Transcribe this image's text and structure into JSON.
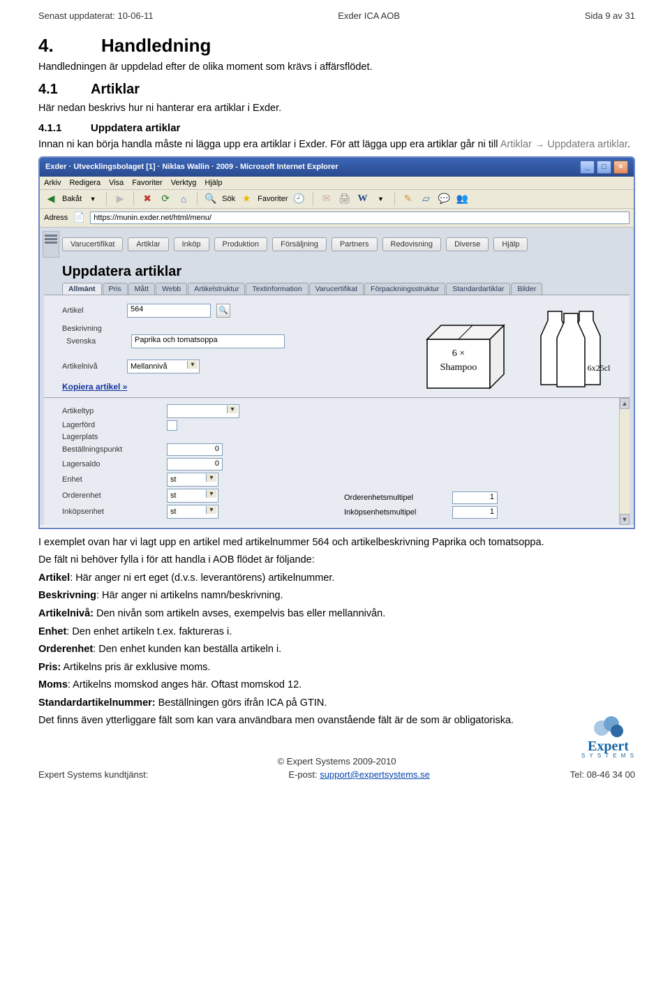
{
  "header": {
    "left": "Senast uppdaterat: 10-06-11",
    "center": "Exder ICA AOB",
    "right": "Sida 9 av 31"
  },
  "h1": {
    "num": "4.",
    "title": "Handledning"
  },
  "p_intro": "Handledningen är uppdelad efter de olika moment som krävs i affärsflödet.",
  "h2": {
    "num": "4.1",
    "title": "Artiklar"
  },
  "p_41": "Här nedan beskrivs hur ni hanterar era artiklar i Exder.",
  "h3": {
    "num": "4.1.1",
    "title": "Uppdatera artiklar"
  },
  "p_411a": "Innan ni kan börja handla måste ni lägga upp era artiklar i Exder. För att lägga upp era artiklar går ni till ",
  "p_411b": "Artiklar → Uppdatera artiklar",
  "p_411c": ".",
  "ie": {
    "title": "Exder · Utvecklingsbolaget [1] · Niklas Wallin · 2009 - Microsoft Internet Explorer",
    "menus": [
      "Arkiv",
      "Redigera",
      "Visa",
      "Favoriter",
      "Verktyg",
      "Hjälp"
    ],
    "toolbar": {
      "back": "Bakåt",
      "sok": "Sök",
      "fav": "Favoriter"
    },
    "address_label": "Adress",
    "address_url": "https://munin.exder.net/html/menu/"
  },
  "app": {
    "tabs": [
      "Varucertifikat",
      "Artiklar",
      "Inköp",
      "Produktion",
      "Försäljning",
      "Partners",
      "Redovisning",
      "Diverse",
      "Hjälp"
    ],
    "page_title": "Uppdatera artiklar",
    "subtabs": [
      "Allmänt",
      "Pris",
      "Mått",
      "Webb",
      "Artikelstruktur",
      "Textinformation",
      "Varucertifikat",
      "Förpackningsstruktur",
      "Standardartiklar",
      "Bilder"
    ],
    "form": {
      "artikel_label": "Artikel",
      "artikel_value": "564",
      "beskrivning_label": "Beskrivning",
      "svenska_label": "Svenska",
      "svenska_value": "Paprika och tomatsoppa",
      "artikelniva_label": "Artikelnivå",
      "artikelniva_value": "Mellannivå",
      "kopiera": "Kopiera artikel »",
      "box_text1": "6 ×",
      "box_text2": "Shampoo",
      "bottle_text": "6x25cl"
    },
    "lower": {
      "rows": [
        {
          "label": "Artikeltyp",
          "type": "select",
          "value": ""
        },
        {
          "label": "Lagerförd",
          "type": "checkbox"
        },
        {
          "label": "Lagerplats",
          "type": "blank"
        },
        {
          "label": "Beställningspunkt",
          "type": "num",
          "value": "0"
        },
        {
          "label": "Lagersaldo",
          "type": "num",
          "value": "0"
        },
        {
          "label": "Enhet",
          "type": "select",
          "value": "st"
        },
        {
          "label": "Orderenhet",
          "type": "select",
          "value": "st"
        },
        {
          "label": "Inköpsenhet",
          "type": "select",
          "value": "st"
        }
      ],
      "right": [
        {
          "label": "Orderenhetsmultipel",
          "value": "1"
        },
        {
          "label": "Inköpsenhetsmultipel",
          "value": "1"
        }
      ]
    }
  },
  "after": {
    "p1": "I exemplet ovan har vi lagt upp en artikel med artikelnummer 564 och artikelbeskrivning Paprika och tomatsoppa.",
    "p2": "De fält ni behöver fylla i för att handla i AOB flödet är följande:",
    "lines": [
      {
        "b": "Artikel",
        "t": ": Här anger ni ert eget (d.v.s. leverantörens) artikelnummer."
      },
      {
        "b": "Beskrivning",
        "t": ": Här anger ni artikelns namn/beskrivning."
      },
      {
        "b": "Artikelnivå:",
        "t": " Den nivån som artikeln avses, exempelvis bas eller mellannivån."
      },
      {
        "b": "Enhet",
        "t": ": Den enhet artikeln t.ex. faktureras i."
      },
      {
        "b": "Orderenhet",
        "t": ": Den enhet kunden kan beställa artikeln i."
      },
      {
        "b": "Pris:",
        "t": " Artikelns pris är exklusive moms."
      },
      {
        "b": "Moms",
        "t": ": Artikelns momskod anges här. Oftast momskod 12."
      },
      {
        "b": "Standardartikelnummer:",
        "t": " Beställningen görs ifrån ICA på GTIN."
      }
    ],
    "last": "Det finns även ytterliggare fält som kan vara användbara men ovanstående fält är de som är obligatoriska."
  },
  "footer": {
    "copyright": "© Expert Systems 2009-2010",
    "left": "Expert Systems kundtjänst:",
    "center_lbl": "E-post: ",
    "center_link": "support@expertsystems.se",
    "right": "Tel: 08-46 34 00",
    "logo_top": "Expert",
    "logo_bottom": "S Y S T E M S"
  }
}
